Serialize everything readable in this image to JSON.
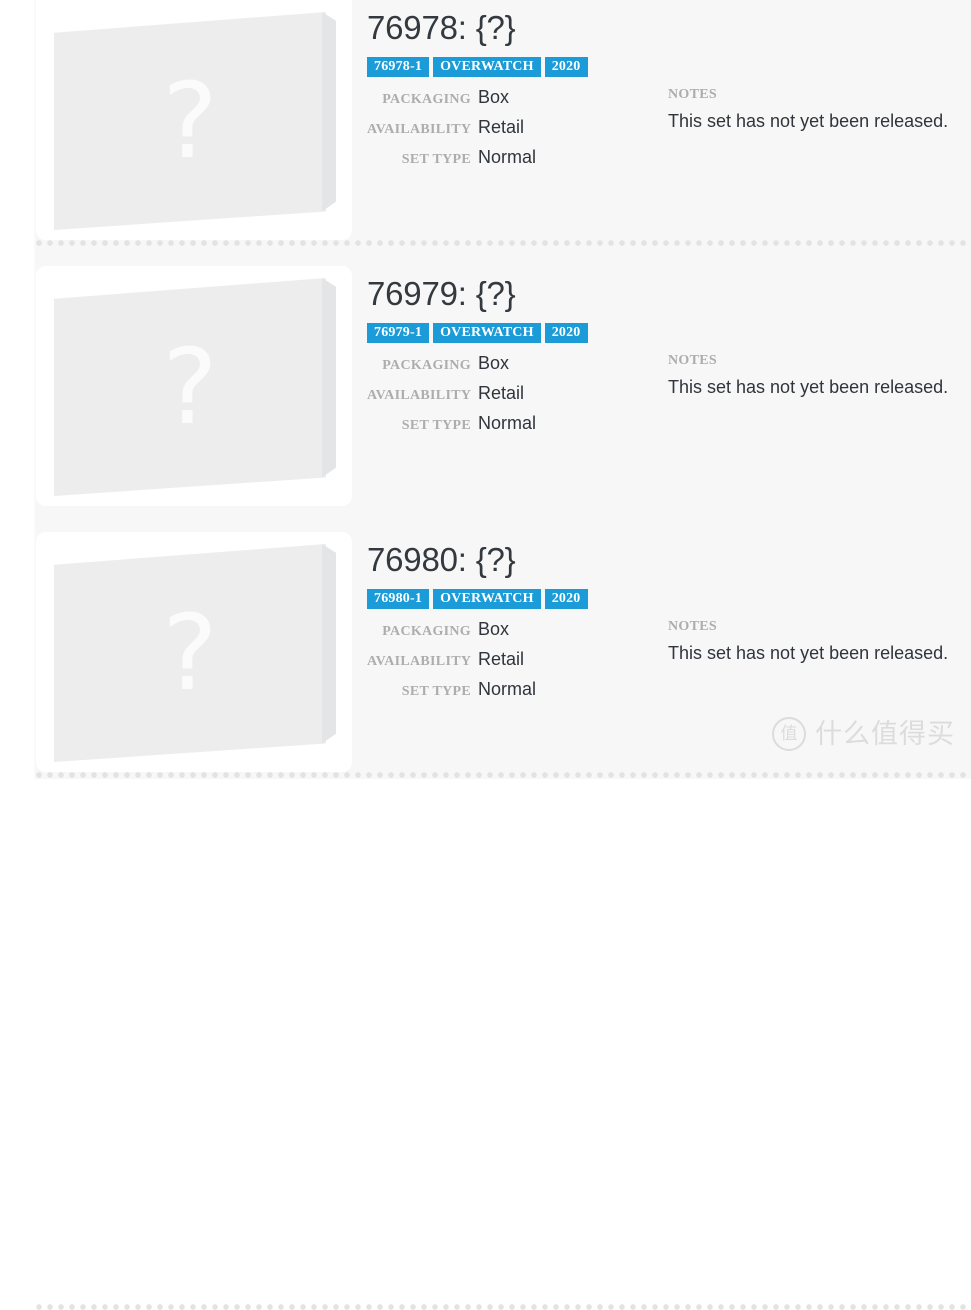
{
  "labels": {
    "packaging": "PACKAGING",
    "availability": "AVAILABILITY",
    "set_type": "SET TYPE",
    "notes": "NOTES"
  },
  "placeholder": {
    "glyph": "?"
  },
  "colors": {
    "badge_background": "#1b9bd8",
    "badge_text": "#ffffff",
    "title_text": "#33393f",
    "label_text": "#adadad",
    "value_text": "#2f353b",
    "panel_background": "#ffffff",
    "page_background": "#f7f7f8",
    "divider_dot": "#e2e3e5",
    "placeholder_box": "#ededee"
  },
  "sets": [
    {
      "title": "76978: {?}",
      "badges": [
        "76978-1",
        "OVERWATCH",
        "2020"
      ],
      "packaging": "Box",
      "availability": "Retail",
      "set_type": "Normal",
      "notes": "This set has not yet been released."
    },
    {
      "title": "76979: {?}",
      "badges": [
        "76979-1",
        "OVERWATCH",
        "2020"
      ],
      "packaging": "Box",
      "availability": "Retail",
      "set_type": "Normal",
      "notes": "This set has not yet been released."
    },
    {
      "title": "76980: {?}",
      "badges": [
        "76980-1",
        "OVERWATCH",
        "2020"
      ],
      "packaging": "Box",
      "availability": "Retail",
      "set_type": "Normal",
      "notes": "This set has not yet been released."
    }
  ],
  "watermark": {
    "logo_glyph": "值",
    "text": "什么值得买"
  }
}
